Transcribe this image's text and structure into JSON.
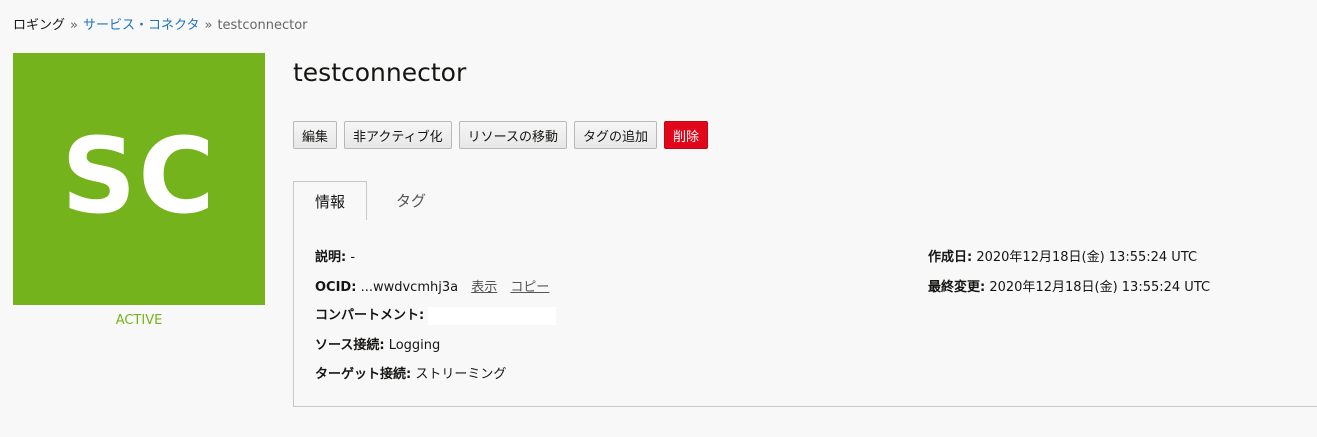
{
  "breadcrumb": {
    "root": "ロギング",
    "separator": "»",
    "parent": "サービス・コネクタ",
    "current": "testconnector"
  },
  "avatar": {
    "initials": "SC",
    "background_color": "#74b31b"
  },
  "status": {
    "label": "ACTIVE",
    "color": "#74b31b"
  },
  "title": "testconnector",
  "actions": {
    "edit": "編集",
    "deactivate": "非アクティブ化",
    "move_resource": "リソースの移動",
    "add_tags": "タグの追加",
    "delete": "削除",
    "delete_color": "#e1071b"
  },
  "tabs": {
    "info": "情報",
    "tags": "タグ"
  },
  "details": {
    "description_label": "説明:",
    "description_value": "-",
    "ocid_label": "OCID:",
    "ocid_value": "...wwdvcmhj3a",
    "ocid_show": "表示",
    "ocid_copy": "コピー",
    "compartment_label": "コンパートメント:",
    "source_label": "ソース接続:",
    "source_value": "Logging",
    "target_label": "ターゲット接続:",
    "target_value": "ストリーミング",
    "created_label": "作成日:",
    "created_value": "2020年12月18日(金) 13:55:24 UTC",
    "modified_label": "最終変更:",
    "modified_value": "2020年12月18日(金) 13:55:24 UTC"
  }
}
